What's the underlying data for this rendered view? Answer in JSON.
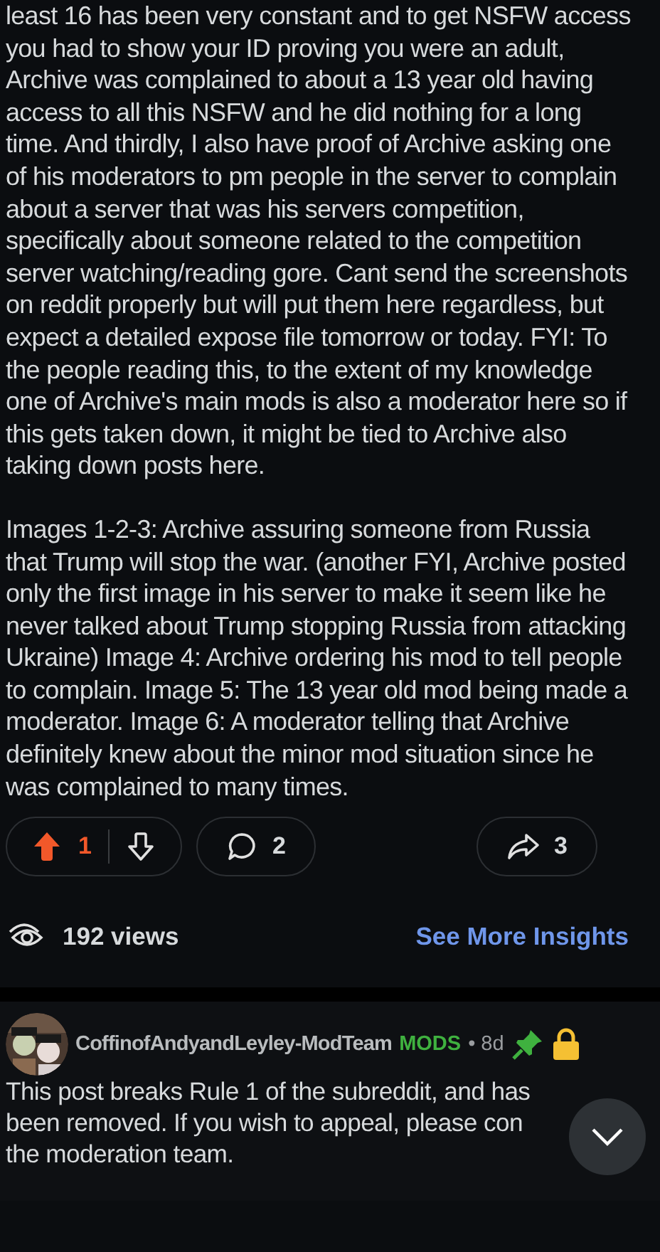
{
  "post": {
    "paragraphs": [
      "least 16 has been very constant and to get NSFW access you had to show your ID proving you were an adult, Archive was complained to about a 13 year old having access to all this NSFW and he did nothing for a long time. And thirdly, I also have proof of Archive asking one of his moderators to pm people in the server to complain about a server that was his servers competition, specifically about someone related to the competition server watching/reading gore. Cant send the screenshots on reddit properly but will put them here regardless, but expect a detailed expose file tomorrow or today. FYI: To the people reading this, to the extent of my knowledge one of Archive's main mods is also a moderator here so if this gets taken down, it might be tied to Archive also taking down posts here.",
      "Images 1-2-3: Archive assuring someone from Russia that Trump will stop the war. (another FYI, Archive posted only the first image in his server to make it seem like he never talked about Trump stopping Russia from attacking Ukraine) Image 4: Archive ordering his mod to tell people to complain. Image 5: The 13 year old mod being made a moderator. Image 6: A moderator telling that Archive definitely knew about the minor mod situation since he was complained to many times."
    ]
  },
  "actions": {
    "upvoted": true,
    "votes": "1",
    "comments": "2",
    "shares": "3"
  },
  "insights": {
    "views": "192 views",
    "link": "See More Insights"
  },
  "comment": {
    "author": "CoffinofAndyandLeyley-ModTeam",
    "badge": "MODS",
    "age": "• 8d",
    "pinned": true,
    "locked": true,
    "lines": [
      "This post breaks Rule 1 of the subreddit, and has",
      "been removed. If you wish to appeal, please con",
      "the moderation team."
    ]
  }
}
